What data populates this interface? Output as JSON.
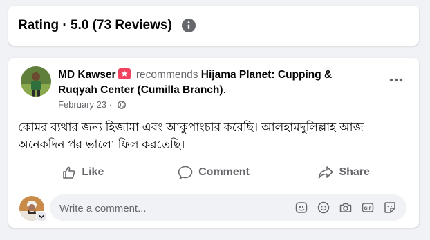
{
  "rating": {
    "title": "Rating · 5.0 (73 Reviews)",
    "info_icon": "info-circle-icon"
  },
  "post": {
    "author": "MD Kawser",
    "recommends": "recommends",
    "page_name": "Hijama Planet: Cupping & Ruqyah Center (Cumilla Branch)",
    "period": ".",
    "date": "February 23",
    "dot": " · ",
    "text": "কোমর ব্যথার জন্য হিজামা এবং আকুপাংচার করেছি। আলহামদুলিল্লাহ আজ অনেকদিন পর ভালো ফিল করতেছি।",
    "icons": {
      "recommend": "recommend-flag-icon",
      "privacy": "globe-icon",
      "more": "more-dots-icon"
    }
  },
  "actions": {
    "like": "Like",
    "comment": "Comment",
    "share": "Share"
  },
  "comment_box": {
    "placeholder": "Write a comment..."
  },
  "colors": {
    "accent_red": "#f3425f",
    "muted": "#65676b",
    "background": "#f0f2f5"
  }
}
